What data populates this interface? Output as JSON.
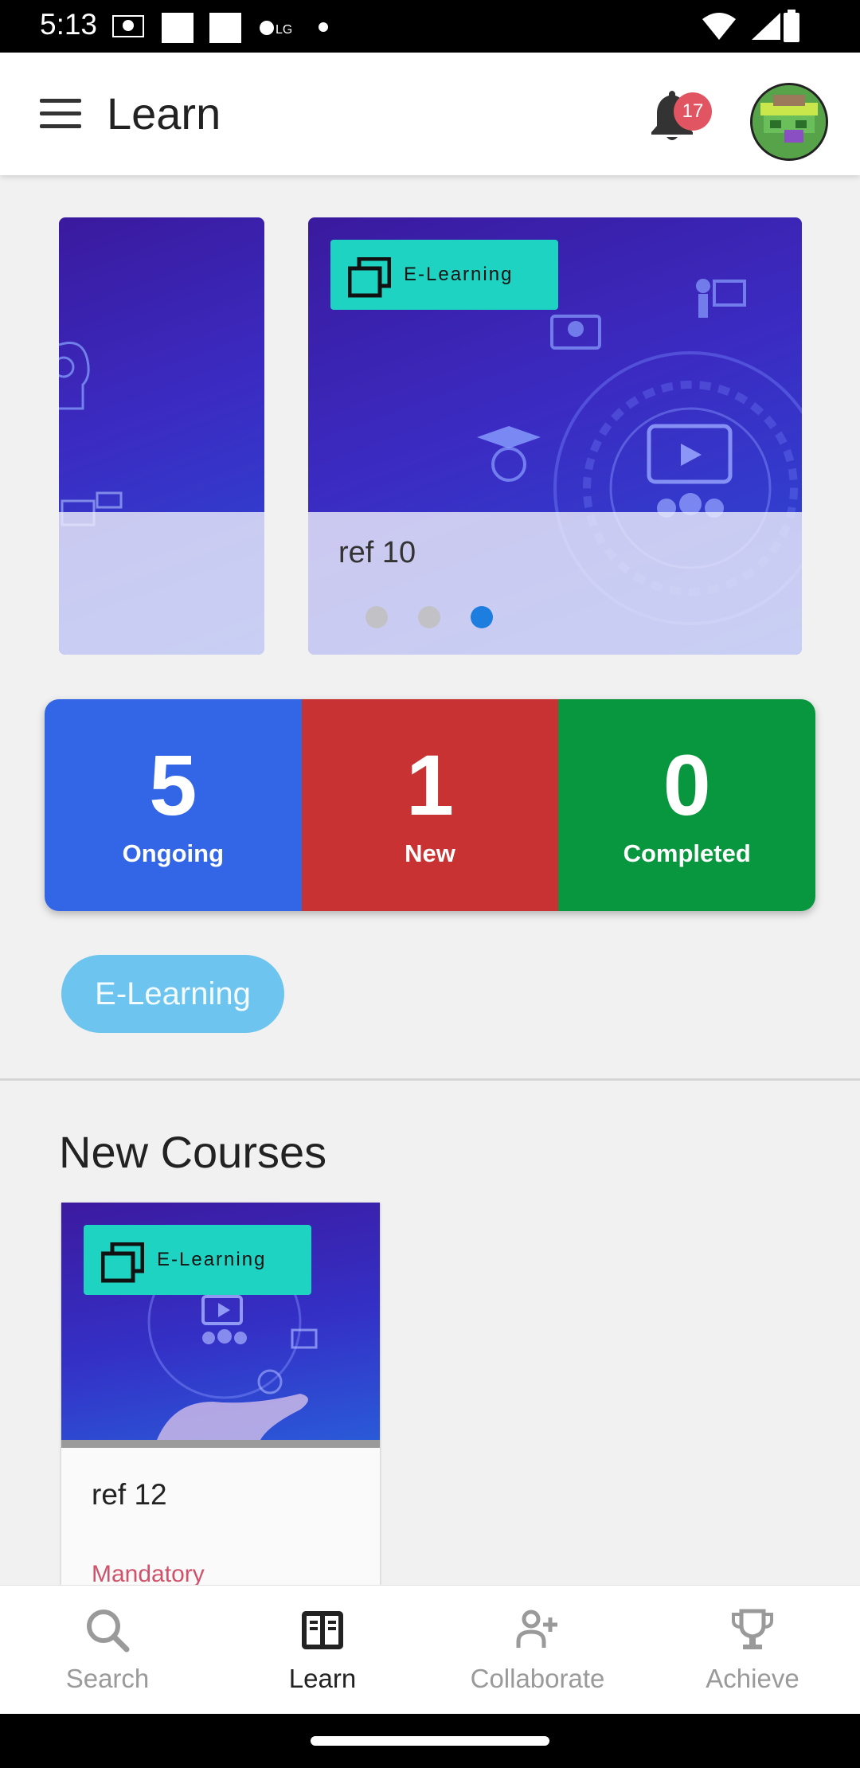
{
  "status_bar": {
    "time": "5:13"
  },
  "app_bar": {
    "title": "Learn",
    "notification_count": "17"
  },
  "carousel": {
    "slides": [
      {
        "tag": "E-Learning",
        "title": "ref 10"
      }
    ],
    "active_index": 2,
    "dot_count": 3
  },
  "stats": [
    {
      "value": "5",
      "label": "Ongoing",
      "color": "#3366e6"
    },
    {
      "value": "1",
      "label": "New",
      "color": "#c83232"
    },
    {
      "value": "0",
      "label": "Completed",
      "color": "#08973f"
    }
  ],
  "filter_chip": {
    "label": "E-Learning"
  },
  "new_courses": {
    "title": "New Courses",
    "items": [
      {
        "tag": "E-Learning",
        "title": "ref 12",
        "meta": "Mandatory"
      }
    ]
  },
  "bottom_nav": {
    "items": [
      {
        "label": "Search",
        "icon": "search-icon"
      },
      {
        "label": "Learn",
        "icon": "book-icon",
        "active": true
      },
      {
        "label": "Collaborate",
        "icon": "add-person-icon"
      },
      {
        "label": "Achieve",
        "icon": "trophy-icon"
      }
    ]
  }
}
